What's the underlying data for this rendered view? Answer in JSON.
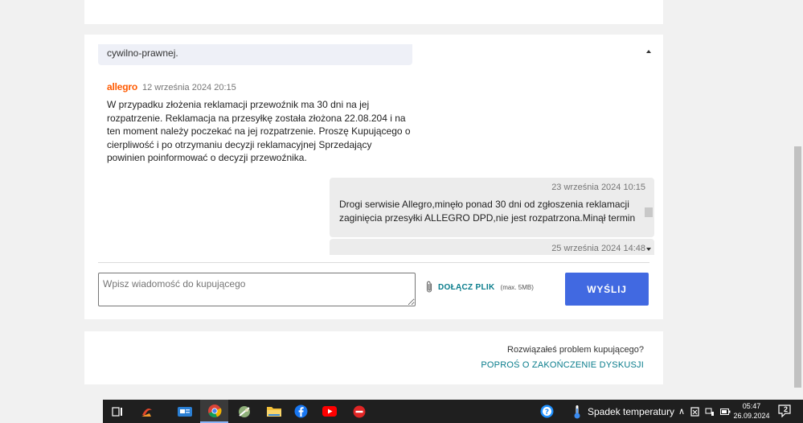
{
  "thread": {
    "earlier_tail_text": "cywilno-prawnej.",
    "seller_message": {
      "sender_logo": "allegro",
      "date": "12 września 2024 20:15",
      "text": "W przypadku złożenia reklamacji przewoźnik ma 30 dni na jej rozpatrzenie. Reklamacja na przesyłkę została złożona 22.08.204 i na ten moment należy poczekać na jej rozpatrzenie. Proszę Kupującego o cierpliwość i po otrzymaniu decyzji reklamacyjnej Sprzedający powinien poinformować o decyzji przewoźnika."
    },
    "buyer_messages": [
      {
        "date": "23 września 2024 10:15",
        "text": "Drogi serwisie Allegro,minęło ponad 30 dni od zgłoszenia reklamacji zaginięcia przesyłki ALLEGRO DPD,nie jest rozpatrzona.Minął termin"
      },
      {
        "date": "25 września 2024 14:48",
        "text": ""
      }
    ]
  },
  "composer": {
    "placeholder": "Wpisz wiadomość do kupującego",
    "attach_label": "DOŁĄCZ PLIK",
    "attach_hint": "(max. 5MB)",
    "send_label": "WYŚLIJ"
  },
  "end_discussion": {
    "question": "Rozwiązałeś problem kupującego?",
    "link": "POPROŚ O ZAKOŃCZENIE DYSKUSJI"
  },
  "taskbar": {
    "apps": [
      "task-view-icon",
      "app-icon",
      "news-icon",
      "chrome-icon",
      "app-icon-2",
      "file-explorer-icon",
      "facebook-icon",
      "youtube-icon",
      "stop-icon"
    ],
    "weather_text": "Spadek temperatury",
    "time": "05:47",
    "date": "26.09.2024",
    "notification_count": "2"
  },
  "colors": {
    "accent": "#4169e1",
    "link": "#0a7d8c",
    "brand": "#ff5a00"
  }
}
